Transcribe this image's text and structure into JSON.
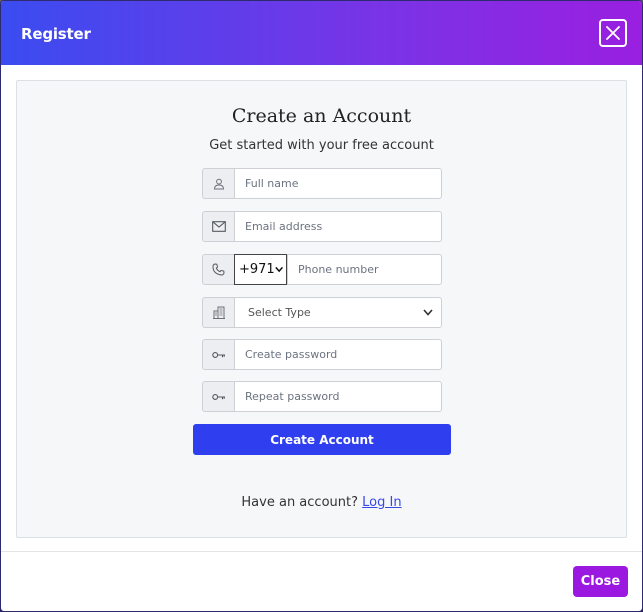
{
  "modal": {
    "title": "Register",
    "close_icon": "close-icon",
    "footer_close_label": "Close"
  },
  "form": {
    "heading": "Create an Account",
    "subheading": "Get started with your free account",
    "full_name": {
      "icon": "user-icon",
      "placeholder": "Full name"
    },
    "email": {
      "icon": "envelope-icon",
      "placeholder": "Email address"
    },
    "phone": {
      "icon": "phone-icon",
      "country_code": "+971",
      "placeholder": "Phone number"
    },
    "type": {
      "icon": "building-icon",
      "selected": "Select Type"
    },
    "password": {
      "icon": "key-icon",
      "placeholder": "Create password"
    },
    "repeat_password": {
      "icon": "key-icon",
      "placeholder": "Repeat password"
    },
    "submit_label": "Create Account",
    "login_prompt": "Have an account?",
    "login_link": "Log In"
  },
  "colors": {
    "header_gradient_start": "#3a4cf0",
    "header_gradient_end": "#9a1fe0",
    "primary_button": "#2f3ff0",
    "close_button": "#9a18e0",
    "link": "#3848e6"
  }
}
